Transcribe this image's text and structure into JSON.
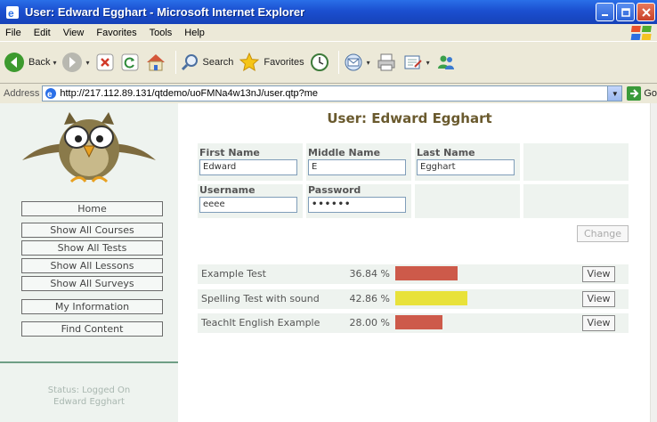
{
  "window": {
    "title": "User: Edward Egghart - Microsoft Internet Explorer"
  },
  "menu": [
    "File",
    "Edit",
    "View",
    "Favorites",
    "Tools",
    "Help"
  ],
  "toolbar": {
    "back_label": "Back",
    "search_label": "Search",
    "favorites_label": "Favorites"
  },
  "address": {
    "label": "Address",
    "url": "http://217.112.89.131/qtdemo/uoFMNa4w13nJ/user.qtp?me",
    "go_label": "Go"
  },
  "sidebar": {
    "nav": [
      "Home",
      "Show All Courses",
      "Show All Tests",
      "Show All Lessons",
      "Show All Surveys",
      "My Information",
      "Find Content"
    ],
    "status_label": "Status: Logged On",
    "status_user": "Edward Egghart"
  },
  "main": {
    "title": "User: Edward Egghart",
    "fields": {
      "first_name_label": "First Name",
      "first_name_value": "Edward",
      "middle_name_label": "Middle Name",
      "middle_name_value": "E",
      "last_name_label": "Last Name",
      "last_name_value": "Egghart",
      "username_label": "Username",
      "username_value": "eeee",
      "password_label": "Password",
      "password_value": "••••••"
    },
    "change_label": "Change",
    "view_label": "View",
    "tests": [
      {
        "name": "Example Test",
        "score": "36.84 %",
        "fraction": 0.3684,
        "color": "#cd5a4a"
      },
      {
        "name": "Spelling Test with sound",
        "score": "42.86 %",
        "fraction": 0.4286,
        "color": "#e8e23a"
      },
      {
        "name": "TeachIt English Example",
        "score": "28.00 %",
        "fraction": 0.28,
        "color": "#cd5a4a"
      }
    ]
  }
}
